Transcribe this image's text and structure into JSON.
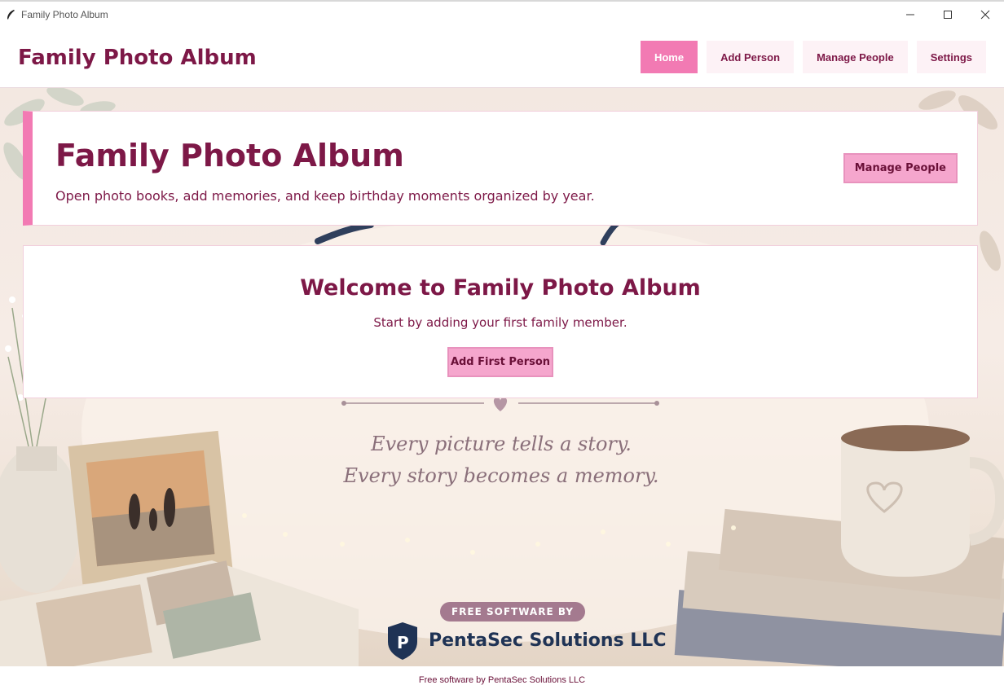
{
  "window": {
    "title": "Family Photo Album",
    "controls": [
      "minimize",
      "maximize",
      "close"
    ]
  },
  "header": {
    "brand": "Family Photo Album",
    "nav": [
      {
        "label": "Home",
        "active": true
      },
      {
        "label": "Add Person",
        "active": false
      },
      {
        "label": "Manage People",
        "active": false
      },
      {
        "label": "Settings",
        "active": false
      }
    ]
  },
  "hero": {
    "title": "Family Photo Album",
    "subtitle": "Open photo books, add memories, and keep birthday moments organized by year.",
    "button": "Manage People"
  },
  "welcome": {
    "title": "Welcome to Family Photo Album",
    "subtitle": "Start by adding your first family member.",
    "button": "Add First Person"
  },
  "background": {
    "quote_line1": "Every picture tells a story.",
    "quote_line2": "Every story becomes a memory.",
    "badge": "FREE SOFTWARE BY",
    "company": "PentaSec Solutions LLC"
  },
  "footer": {
    "text": "Free software by PentaSec Solutions LLC"
  },
  "colors": {
    "accent": "#f27ab3",
    "brand": "#7d1847",
    "button_bg": "#f5a6cd"
  }
}
